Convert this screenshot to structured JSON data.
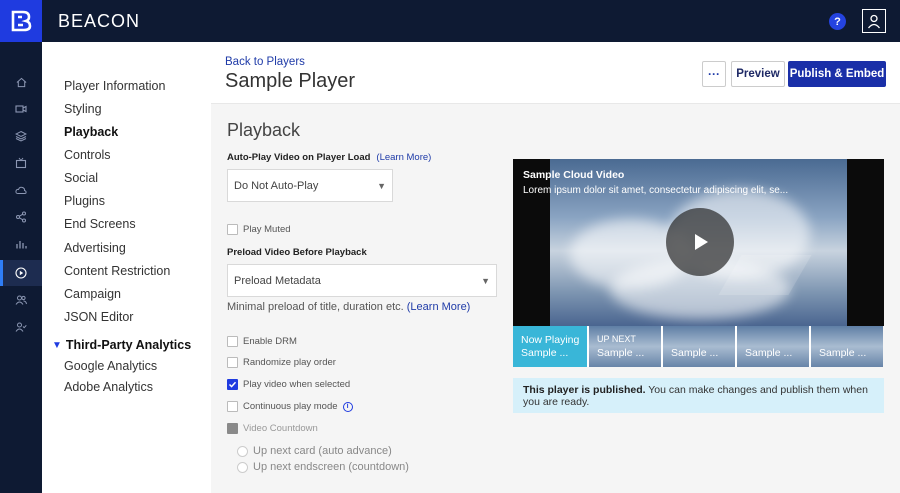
{
  "app": {
    "brand": "BEACON"
  },
  "topbar": {
    "help_label": "?"
  },
  "rail": {
    "items": [
      {
        "name": "home-icon",
        "active": false
      },
      {
        "name": "video-icon",
        "active": false
      },
      {
        "name": "layers-icon",
        "active": false
      },
      {
        "name": "tv-icon",
        "active": false
      },
      {
        "name": "cloud-icon",
        "active": false
      },
      {
        "name": "share-icon",
        "active": false
      },
      {
        "name": "analytics-icon",
        "active": false
      },
      {
        "name": "player-icon",
        "active": true
      },
      {
        "name": "users-icon",
        "active": false
      },
      {
        "name": "user-check-icon",
        "active": false
      }
    ]
  },
  "subnav": {
    "items": [
      {
        "label": "Player Information",
        "active": false
      },
      {
        "label": "Styling",
        "active": false
      },
      {
        "label": "Playback",
        "active": true
      },
      {
        "label": "Controls",
        "active": false
      },
      {
        "label": "Social",
        "active": false
      },
      {
        "label": "Plugins",
        "active": false
      },
      {
        "label": "End Screens",
        "active": false
      },
      {
        "label": "Advertising",
        "active": false
      },
      {
        "label": "Content Restriction",
        "active": false
      },
      {
        "label": "Campaign",
        "active": false
      },
      {
        "label": "JSON Editor",
        "active": false
      }
    ],
    "section": {
      "label": "Third-Party Analytics",
      "expanded": true
    },
    "section_items": [
      {
        "label": "Google Analytics"
      },
      {
        "label": "Adobe Analytics"
      }
    ]
  },
  "header": {
    "back_label": "Back to Players",
    "title": "Sample Player",
    "more_label": "···",
    "preview_label": "Preview",
    "publish_label": "Publish & Embed"
  },
  "playback": {
    "title": "Playback",
    "autoplay": {
      "label": "Auto-Play Video on Player Load",
      "learn_more": "(Learn More)",
      "value": "Do Not Auto-Play"
    },
    "play_muted": {
      "label": "Play Muted",
      "checked": false
    },
    "preload": {
      "label": "Preload Video Before Playback",
      "value": "Preload Metadata",
      "help": "Minimal preload of title, duration etc.",
      "learn_more": "(Learn More)"
    },
    "options": [
      {
        "label": "Enable DRM",
        "checked": false
      },
      {
        "label": "Randomize play order",
        "checked": false
      },
      {
        "label": "Play video when selected",
        "checked": true
      },
      {
        "label": "Continuous play mode",
        "checked": false,
        "info": true
      }
    ],
    "video_countdown": {
      "label": "Video Countdown",
      "disabled": true
    },
    "countdown_options": [
      {
        "label": "Up next card (auto advance)"
      },
      {
        "label": "Up next endscreen (countdown)"
      }
    ]
  },
  "player_preview": {
    "video_title": "Sample Cloud Video",
    "video_desc": "Lorem ipsum dolor sit amet, consectetur adipiscing elit, se...",
    "playlist": [
      {
        "top": "Now Playing",
        "bottom": "Sample ..."
      },
      {
        "top": "UP NEXT",
        "bottom": "Sample ..."
      },
      {
        "top": "",
        "bottom": "Sample ..."
      },
      {
        "top": "",
        "bottom": "Sample ..."
      },
      {
        "top": "",
        "bottom": "Sample ..."
      }
    ]
  },
  "notice": {
    "bold": "This player is published.",
    "text": " You can make changes and publish them when you are ready."
  },
  "colors": {
    "topbar": "#0e1a33",
    "accent": "#1f3be0",
    "primary_button": "#1a2fa8",
    "now_playing": "#39b6d8",
    "notice_bg": "#d6f0fa"
  }
}
